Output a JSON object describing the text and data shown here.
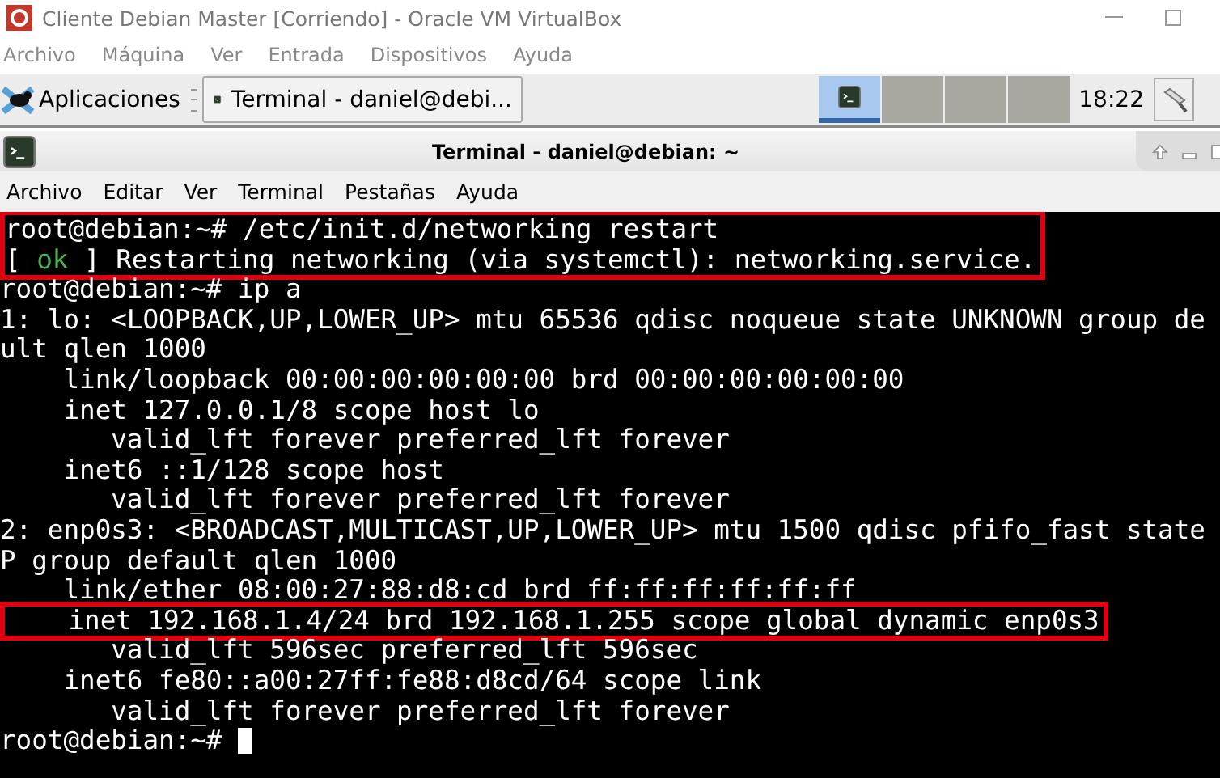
{
  "window": {
    "title": "Cliente Debian Master [Corriendo] - Oracle VM VirtualBox"
  },
  "menu": [
    "Archivo",
    "Máquina",
    "Ver",
    "Entrada",
    "Dispositivos",
    "Ayuda"
  ],
  "panel": {
    "apps_label": "Aplicaciones",
    "task": "Terminal - daniel@debi...",
    "workspaces": [
      {
        "selected": true
      },
      {
        "selected": false
      },
      {
        "selected": false
      },
      {
        "selected": false
      }
    ],
    "clock": "18:22"
  },
  "terminal": {
    "title": "Terminal - daniel@debian: ~",
    "menu": [
      "Archivo",
      "Editar",
      "Ver",
      "Terminal",
      "Pestañas",
      "Ayuda"
    ],
    "blocks": [
      {
        "highlight": true,
        "lines": [
          [
            {
              "text": "root@debian:~# /etc/init.d/networking restart"
            }
          ],
          [
            {
              "text": "[ "
            },
            {
              "text": "ok",
              "kind": "ok"
            },
            {
              "text": " ] Restarting networking (via systemctl): networking.service."
            }
          ]
        ]
      },
      {
        "highlight": false,
        "lines": [
          [
            {
              "text": "root@debian:~# ip a"
            }
          ],
          [
            {
              "text": "1: lo: <LOOPBACK,UP,LOWER_UP> mtu 65536 qdisc noqueue state UNKNOWN group de"
            }
          ],
          [
            {
              "text": "ult qlen 1000"
            }
          ],
          [
            {
              "text": "    link/loopback 00:00:00:00:00:00 brd 00:00:00:00:00:00"
            }
          ],
          [
            {
              "text": "    inet 127.0.0.1/8 scope host lo"
            }
          ],
          [
            {
              "text": "       valid_lft forever preferred_lft forever"
            }
          ],
          [
            {
              "text": "    inet6 ::1/128 scope host"
            }
          ],
          [
            {
              "text": "       valid_lft forever preferred_lft forever"
            }
          ],
          [
            {
              "text": "2: enp0s3: <BROADCAST,MULTICAST,UP,LOWER_UP> mtu 1500 qdisc pfifo_fast state"
            }
          ],
          [
            {
              "text": "P group default qlen 1000"
            }
          ],
          [
            {
              "text": "    link/ether 08:00:27:88:d8:cd brd ff:ff:ff:ff:ff:ff"
            }
          ]
        ]
      },
      {
        "highlight": true,
        "lines": [
          [
            {
              "text": "    inet 192.168.1.4/24 brd 192.168.1.255 scope global dynamic enp0s3"
            }
          ]
        ]
      },
      {
        "highlight": false,
        "lines": [
          [
            {
              "text": "       valid_lft 596sec preferred_lft 596sec"
            }
          ],
          [
            {
              "text": "    inet6 fe80::a00:27ff:fe88:d8cd/64 scope link"
            }
          ],
          [
            {
              "text": "       valid_lft forever preferred_lft forever"
            }
          ],
          [
            {
              "text": "root@debian:~# "
            }
          ]
        ]
      }
    ],
    "cursor": true
  }
}
